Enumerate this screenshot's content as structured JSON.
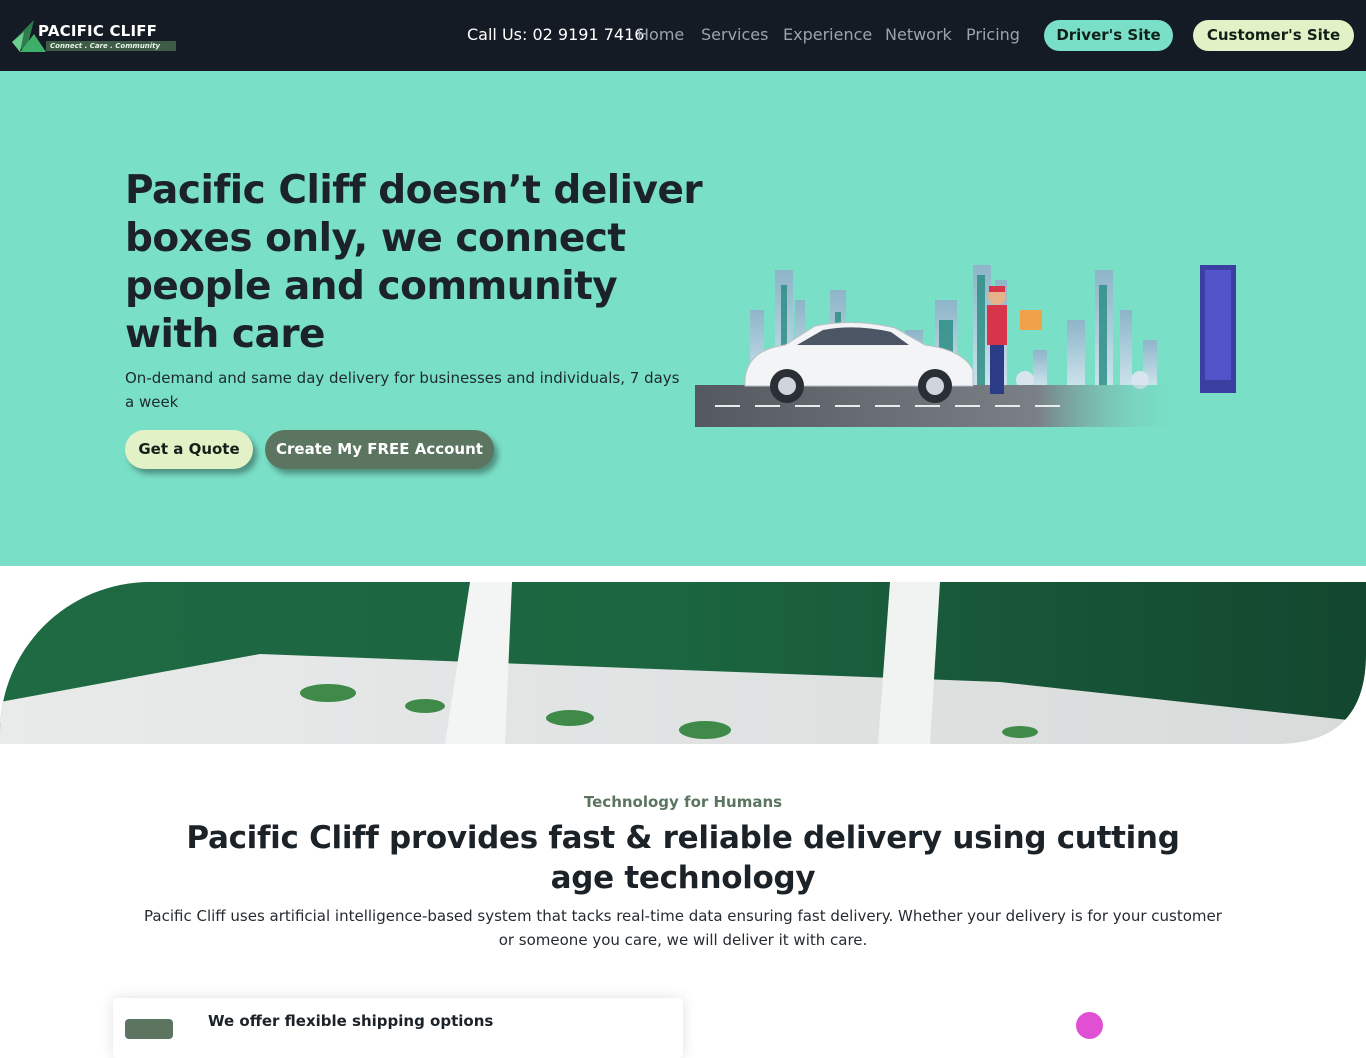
{
  "nav": {
    "logo_title": "PACIFIC CLIFF",
    "logo_tagline": "Connect . Care . Community",
    "call": "Call Us: 02 9191 7416",
    "links": [
      "Home",
      "Services",
      "Experience",
      "Network",
      "Pricing"
    ],
    "driver_button": "Driver's Site",
    "customer_button": "Customer's Site"
  },
  "hero": {
    "title": "Pacific Cliff doesn’t deliver boxes only, we connect people and community with care",
    "subtitle": "On-demand and same day delivery for businesses and individuals, 7 days a week",
    "quote_button": "Get a Quote",
    "create_button": "Create My FREE Account"
  },
  "section": {
    "kicker": "Technology for Humans",
    "title": "Pacific Cliff provides fast & reliable delivery using cutting age technology",
    "description": "Pacific Cliff uses artificial intelligence-based system that tacks real-time data ensuring fast delivery. Whether your delivery is for your customer or someone you care, we will deliver it with care.",
    "card_title": "We offer flexible shipping options"
  },
  "colors": {
    "nav_bg": "#141b25",
    "hero_bg": "#79dfc6",
    "accent_green": "#5b7560",
    "driver_button": "#79dfc6",
    "customer_button": "#e3f2c6"
  }
}
